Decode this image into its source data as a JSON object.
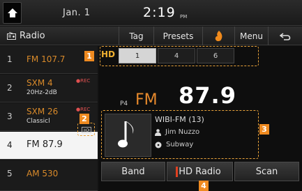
{
  "status": {
    "date": "Jan.  1",
    "time": "2:19",
    "ampm": "PM"
  },
  "menubar": {
    "source": "Radio",
    "buttons": [
      {
        "name": "tag",
        "label": "Tag"
      },
      {
        "name": "presets",
        "label": "Presets"
      },
      {
        "name": "menu",
        "label": "Menu"
      }
    ]
  },
  "presets": [
    {
      "num": "1",
      "station": "FM 107.7",
      "sub": "",
      "rec": ""
    },
    {
      "num": "2",
      "station": "SXM 4",
      "sub": "20Hz-2dB",
      "rec": "●REC"
    },
    {
      "num": "3",
      "station": "SXM 26",
      "sub": "Classicl",
      "rec": "●REC"
    },
    {
      "num": "4",
      "station": "FM 87.9",
      "sub": "",
      "rec": ""
    },
    {
      "num": "5",
      "station": "AM 530",
      "sub": "",
      "rec": ""
    }
  ],
  "hd_channels": [
    "1",
    "4",
    "6"
  ],
  "tuner": {
    "preset_tag": "P4",
    "band": "FM",
    "frequency": "87.9"
  },
  "info": {
    "station": "WIBI-FM  (13)",
    "artist": "Jim Nuzzo",
    "song": "Subway"
  },
  "bottom": {
    "band": "Band",
    "hd": "HD Radio",
    "scan": "Scan"
  },
  "callouts": [
    "1",
    "2",
    "3",
    "4"
  ],
  "colors": {
    "accent": "#e6892c",
    "callout": "#ef8a20"
  }
}
